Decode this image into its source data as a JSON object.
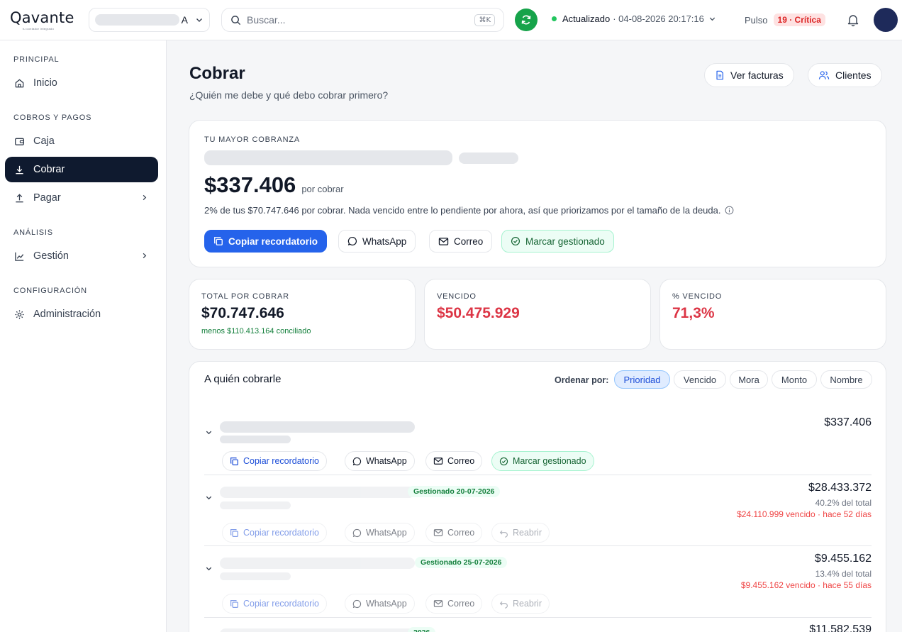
{
  "brand": {
    "name": "Qavante",
    "tagline": "tu contador integrado"
  },
  "topbar": {
    "org_initial": "A",
    "search_placeholder": "Buscar...",
    "search_shortcut": "⌘K",
    "status_label": "Actualizado",
    "status_timestamp": "· 04-08-2026 20:17:16",
    "pulso_label": "Pulso",
    "pulso_badge": "19 · Crítica"
  },
  "sidebar": {
    "sections": [
      {
        "title": "PRINCIPAL",
        "items": [
          {
            "label": "Inicio",
            "icon": "home-icon"
          }
        ]
      },
      {
        "title": "COBROS Y PAGOS",
        "items": [
          {
            "label": "Caja",
            "icon": "wallet-icon"
          },
          {
            "label": "Cobrar",
            "icon": "download-icon",
            "active": true
          },
          {
            "label": "Pagar",
            "icon": "upload-icon"
          }
        ]
      },
      {
        "title": "ANÁLISIS",
        "items": [
          {
            "label": "Gestión",
            "icon": "chart-icon"
          }
        ]
      },
      {
        "title": "CONFIGURACIÓN",
        "items": [
          {
            "label": "Administración",
            "icon": "gear-icon"
          }
        ]
      }
    ]
  },
  "page": {
    "title": "Cobrar",
    "subtitle": "¿Quién me debe y qué debo cobrar primero?",
    "header_buttons": {
      "invoices": "Ver facturas",
      "clients": "Clientes"
    }
  },
  "top_collection": {
    "eyebrow": "TU MAYOR COBRANZA",
    "amount": "$337.406",
    "amount_suffix": "por cobrar",
    "description": "2% de tus $70.747.646 por cobrar. Nada vencido entre lo pendiente por ahora, así que priorizamos por el tamaño de la deuda.",
    "actions": {
      "copy": "Copiar recordatorio",
      "whatsapp": "WhatsApp",
      "email": "Correo",
      "mark": "Marcar gestionado"
    }
  },
  "kpis": [
    {
      "label": "TOTAL POR COBRAR",
      "value": "$70.747.646",
      "note": "menos $110.413.164 conciliado",
      "color": "#111827"
    },
    {
      "label": "VENCIDO",
      "value": "$50.475.929",
      "color": "#dc3545"
    },
    {
      "label": "% VENCIDO",
      "value": "71,3%",
      "color": "#dc3545"
    }
  ],
  "list": {
    "title": "A quién cobrarle",
    "sort_label": "Ordenar por:",
    "sort_options": [
      "Prioridad",
      "Vencido",
      "Mora",
      "Monto",
      "Nombre"
    ],
    "rows": [
      {
        "amount": "$337.406",
        "actions": {
          "copy": "Copiar recordatorio",
          "whatsapp": "WhatsApp",
          "email": "Correo",
          "mark": "Marcar gestionado"
        }
      },
      {
        "amount": "$28.433.372",
        "badge": "Gestionado 20-07-2026",
        "pct": "40.2% del total",
        "overdue": "$24.110.999 vencido · hace 52 días",
        "actions": {
          "copy": "Copiar recordatorio",
          "whatsapp": "WhatsApp",
          "email": "Correo",
          "reopen": "Reabrir"
        }
      },
      {
        "amount": "$9.455.162",
        "badge": "Gestionado 25-07-2026",
        "pct": "13.4% del total",
        "overdue": "$9.455.162 vencido · hace 55 días",
        "actions": {
          "copy": "Copiar recordatorio",
          "whatsapp": "WhatsApp",
          "email": "Correo",
          "reopen": "Reabrir"
        }
      },
      {
        "amount": "$11.582.539",
        "badge": "2026"
      }
    ]
  }
}
